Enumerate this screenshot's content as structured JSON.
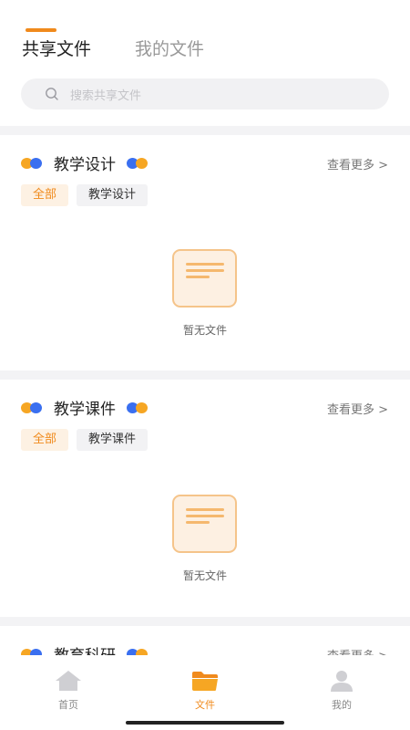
{
  "tabs": [
    {
      "label": "共享文件",
      "active": true
    },
    {
      "label": "我的文件",
      "active": false
    }
  ],
  "search": {
    "placeholder": "搜索共享文件"
  },
  "sections": [
    {
      "title": "教学设计",
      "more": "查看更多 >",
      "chips": [
        "全部",
        "教学设计"
      ],
      "empty_text": "暂无文件"
    },
    {
      "title": "教学课件",
      "more": "查看更多 >",
      "chips": [
        "全部",
        "教学课件"
      ],
      "empty_text": "暂无文件"
    },
    {
      "title": "教育科研",
      "more": "查看更多 >"
    }
  ],
  "bottom_nav": [
    {
      "label": "首页",
      "icon": "home-icon",
      "active": false
    },
    {
      "label": "文件",
      "icon": "folder-icon",
      "active": true
    },
    {
      "label": "我的",
      "icon": "profile-icon",
      "active": false
    }
  ],
  "colors": {
    "accent": "#f08a1c",
    "dot_orange": "#f6a623",
    "dot_blue": "#3a6ff0"
  }
}
